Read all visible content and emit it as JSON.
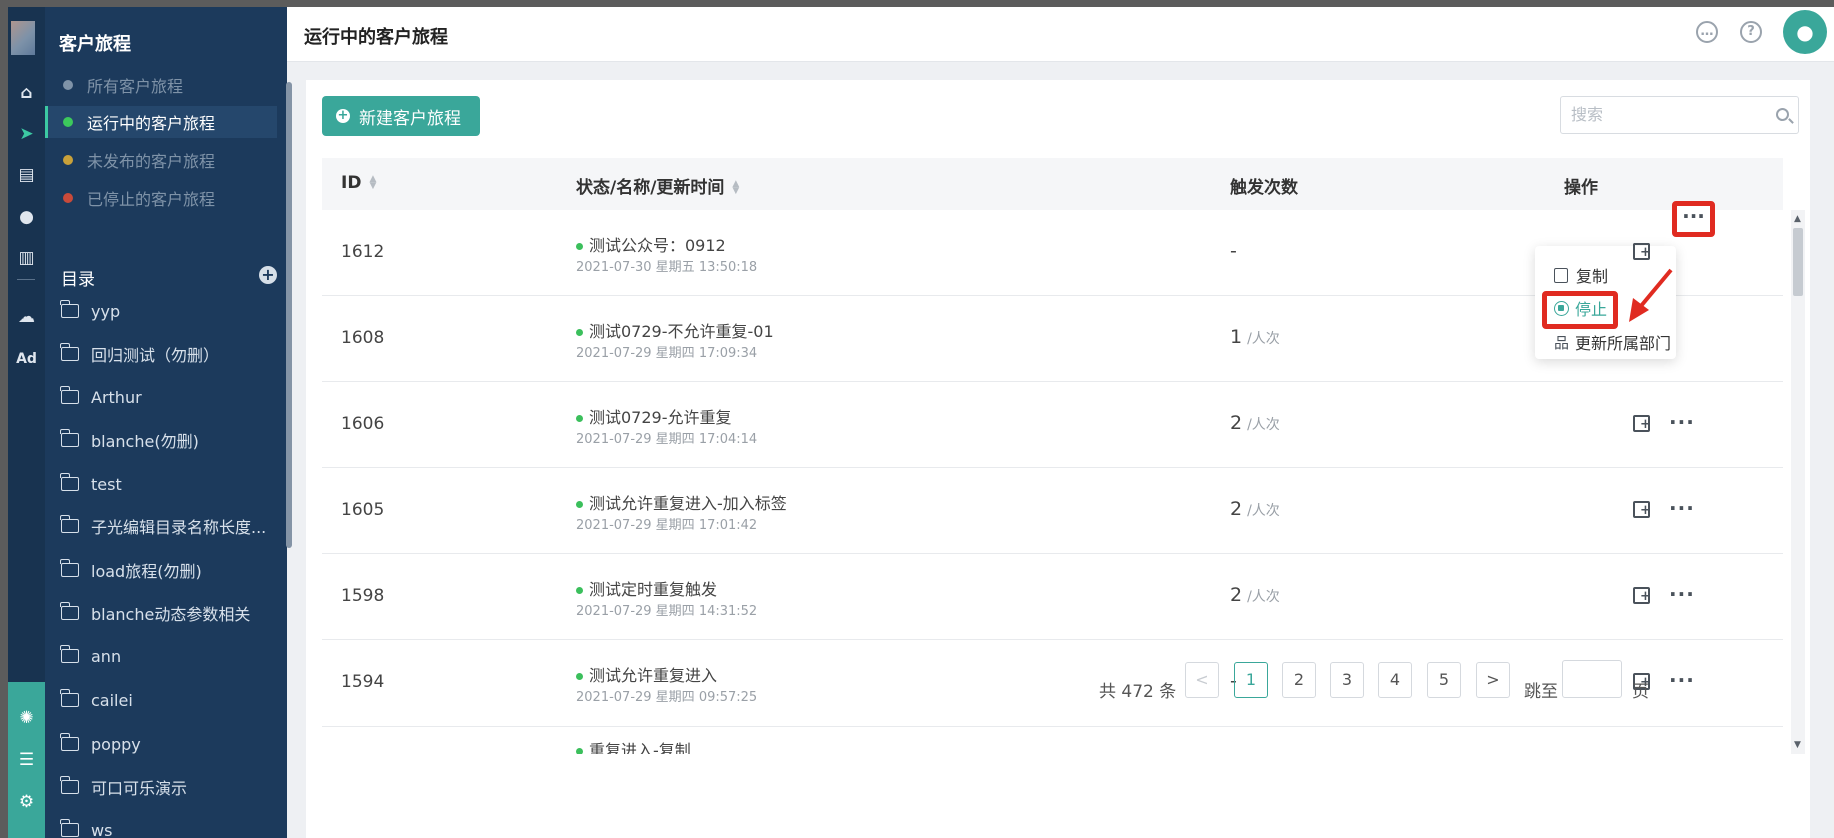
{
  "sidebar": {
    "title": "客户旅程",
    "nav": [
      {
        "label": "所有客户旅程",
        "color": "#7f93a8"
      },
      {
        "label": "运行中的客户旅程",
        "color": "#3cc95c"
      },
      {
        "label": "未发布的客户旅程",
        "color": "#c9a13a"
      },
      {
        "label": "已停止的客户旅程",
        "color": "#c94a3a"
      }
    ],
    "section_label": "目录",
    "folders": [
      "yyp",
      "回归测试（勿删）",
      "Arthur",
      "blanche(勿删)",
      "test",
      "子光编辑目录名称长度...",
      "load旅程(勿删)",
      "blanche动态参数相关",
      "ann",
      "cailei",
      "poppy",
      "可口可乐演示",
      "ws"
    ]
  },
  "rail": {
    "icons": [
      "home-icon",
      "send-icon",
      "layout-icon",
      "user-icon",
      "chart-icon",
      "wechat-icon",
      "ad-icon",
      "hub-icon",
      "server-icon",
      "gear-icon"
    ],
    "ad_label": "Ad"
  },
  "header": {
    "title": "运行中的客户旅程",
    "chat_glyph": "…",
    "help_glyph": "?"
  },
  "toolbar": {
    "new_button": "新建客户旅程",
    "search_placeholder": "搜索"
  },
  "table": {
    "columns": {
      "id": "ID",
      "status": "状态/名称/更新时间",
      "triggers": "触发次数",
      "actions": "操作"
    },
    "rows": [
      {
        "id": "1612",
        "name": "测试公众号：0912",
        "time": "2021-07-30 星期五 13:50:18",
        "count": "-",
        "unit": ""
      },
      {
        "id": "1608",
        "name": "测试0729-不允许重复-01",
        "time": "2021-07-29 星期四 17:09:34",
        "count": "1",
        "unit": "/人次"
      },
      {
        "id": "1606",
        "name": "测试0729-允许重复",
        "time": "2021-07-29 星期四 17:04:14",
        "count": "2",
        "unit": "/人次"
      },
      {
        "id": "1605",
        "name": "测试允许重复进入-加入标签",
        "time": "2021-07-29 星期四 17:01:42",
        "count": "2",
        "unit": "/人次"
      },
      {
        "id": "1598",
        "name": "测试定时重复触发",
        "time": "2021-07-29 星期四 14:31:52",
        "count": "2",
        "unit": "/人次"
      },
      {
        "id": "1594",
        "name": "测试允许重复进入",
        "time": "2021-07-29 星期四 09:57:25",
        "count": "-",
        "unit": ""
      }
    ],
    "partial_row_name": "重复进入-复制"
  },
  "dropdown": {
    "copy": "复制",
    "stop": "停止",
    "update_dept": "更新所属部门"
  },
  "pagination": {
    "total": "共 472 条",
    "prev": "<",
    "next": ">",
    "pages": [
      "1",
      "2",
      "3",
      "4",
      "5"
    ],
    "current": "1",
    "jump_label": "跳至",
    "suffix": "页"
  },
  "colors": {
    "accent": "#3aa79a",
    "highlight": "#e02b21",
    "sidebar": "#1c3a5c"
  }
}
